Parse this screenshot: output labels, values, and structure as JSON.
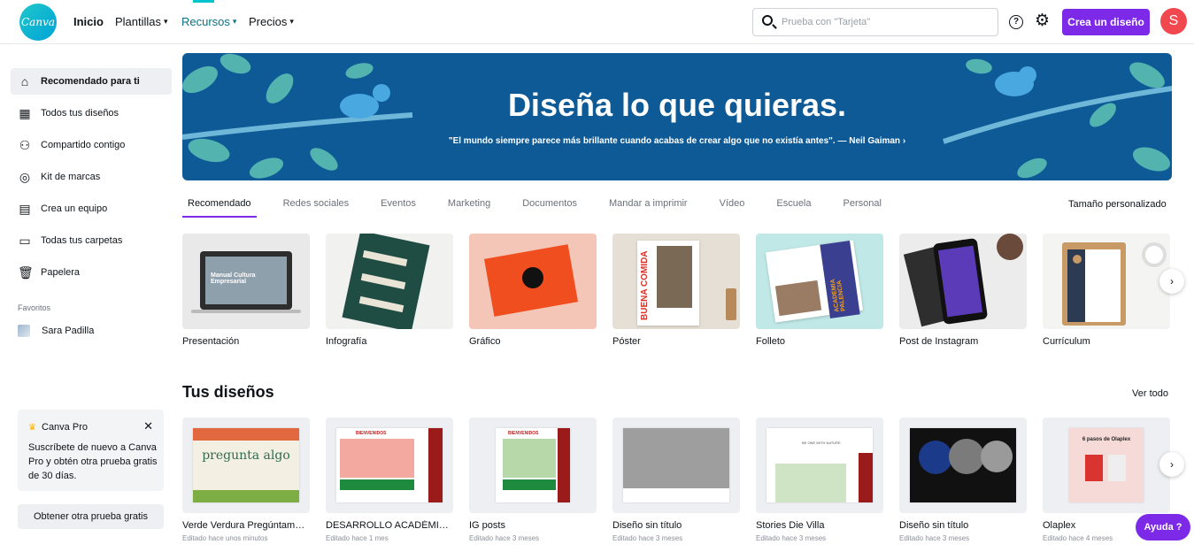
{
  "header": {
    "logo_text": "Canva",
    "nav": [
      {
        "label": "Inicio"
      },
      {
        "label": "Plantillas"
      },
      {
        "label": "Recursos"
      },
      {
        "label": "Precios"
      }
    ],
    "search_placeholder": "Prueba con \"Tarjeta\"",
    "help_label": "?",
    "create_label": "Crea un diseño",
    "avatar_initial": "S"
  },
  "sidebar": {
    "items": [
      {
        "label": "Recomendado para ti",
        "icon": "home-icon"
      },
      {
        "label": "Todos tus diseños",
        "icon": "grid-icon"
      },
      {
        "label": "Compartido contigo",
        "icon": "people-icon"
      },
      {
        "label": "Kit de marcas",
        "icon": "brand-kit-icon"
      },
      {
        "label": "Crea un equipo",
        "icon": "team-icon"
      },
      {
        "label": "Todas tus carpetas",
        "icon": "folder-icon"
      },
      {
        "label": "Papelera",
        "icon": "trash-icon"
      }
    ],
    "favorites_heading": "Favoritos",
    "favorites": [
      {
        "label": "Sara Padilla"
      }
    ],
    "promo": {
      "title": "Canva Pro",
      "text": "Suscríbete de nuevo a Canva Pro y obtén otra prueba gratis de 30 días.",
      "button": "Obtener otra prueba gratis"
    }
  },
  "banner": {
    "title": "Diseña lo que quieras.",
    "quote": "\"El mundo siempre parece más brillante cuando acabas de crear algo que no existía antes\". — Neil Gaiman ›"
  },
  "category_tabs": [
    {
      "label": "Recomendado"
    },
    {
      "label": "Redes sociales"
    },
    {
      "label": "Eventos"
    },
    {
      "label": "Marketing"
    },
    {
      "label": "Documentos"
    },
    {
      "label": "Mandar a imprimir"
    },
    {
      "label": "Vídeo"
    },
    {
      "label": "Escuela"
    },
    {
      "label": "Personal"
    }
  ],
  "custom_size_label": "Tamaño personalizado",
  "design_types": [
    {
      "label": "Presentación",
      "thumb_text": "Manual Cultura Empresarial"
    },
    {
      "label": "Infografía"
    },
    {
      "label": "Gráfico"
    },
    {
      "label": "Póster",
      "thumb_text": "BUENA COMIDA"
    },
    {
      "label": "Folleto",
      "thumb_text": "ACADEMIA PALENCIA"
    },
    {
      "label": "Post de Instagram"
    },
    {
      "label": "Currículum"
    }
  ],
  "your_designs": {
    "title": "Tus diseños",
    "see_all": "Ver todo",
    "items": [
      {
        "name": "Verde Verdura Pregúntame algo",
        "edited": "Editado hace unos minutos",
        "thumb_text": "pregunta algo"
      },
      {
        "name": "DESARROLLO ACADÉMICO",
        "edited": "Editado hace 1 mes",
        "thumb_text": "BIENVENIDOS"
      },
      {
        "name": "IG posts",
        "edited": "Editado hace 3 meses",
        "thumb_text": "BIENVENIDOS"
      },
      {
        "name": "Diseño sin título",
        "edited": "Editado hace 3 meses"
      },
      {
        "name": "Stories Die Villa",
        "edited": "Editado hace 3 meses",
        "thumb_text": "BE ONE WITH NATURE"
      },
      {
        "name": "Diseño sin título",
        "edited": "Editado hace 3 meses"
      },
      {
        "name": "Olaplex",
        "edited": "Editado hace 4 meses",
        "thumb_text": "6 pasos de Olaplex"
      }
    ]
  },
  "help_button": "Ayuda ?",
  "colors": {
    "accent": "#7d2ae8",
    "banner": "#0d5a96",
    "brand": "#00c4cc",
    "avatar": "#f1484f"
  }
}
